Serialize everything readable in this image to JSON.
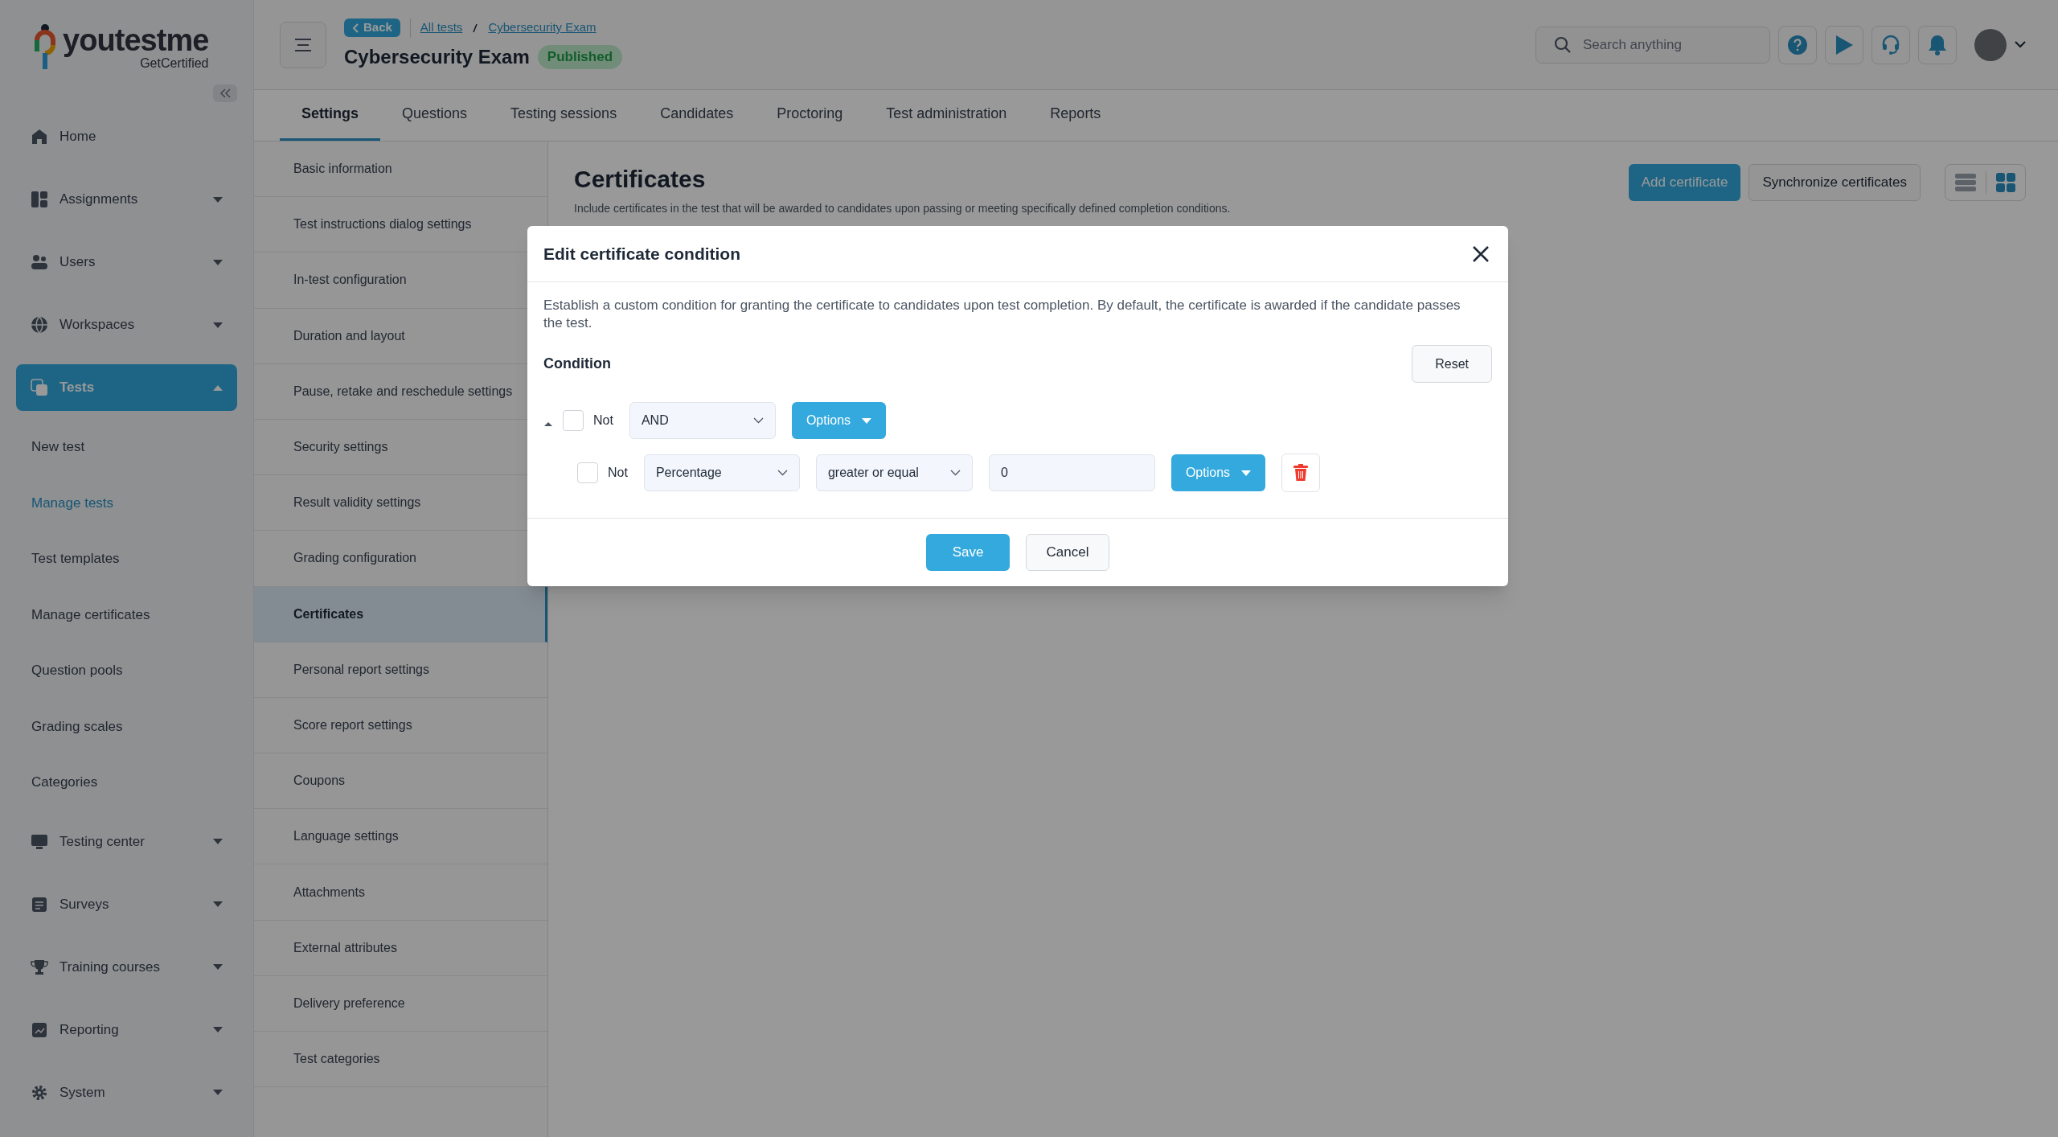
{
  "logo": {
    "name": "youtestme",
    "tagline": "GetCertified"
  },
  "sidebar": {
    "items": [
      {
        "label": "Home",
        "kind": "link",
        "selected": false
      },
      {
        "label": "Assignments",
        "kind": "group",
        "selected": false,
        "expanded": false
      },
      {
        "label": "Users",
        "kind": "group",
        "selected": false,
        "expanded": false
      },
      {
        "label": "Workspaces",
        "kind": "group",
        "selected": false,
        "expanded": false
      },
      {
        "label": "Tests",
        "kind": "group",
        "selected": true,
        "expanded": true,
        "children": [
          {
            "label": "New test",
            "selected": false
          },
          {
            "label": "Manage tests",
            "selected": true
          },
          {
            "label": "Test templates",
            "selected": false
          },
          {
            "label": "Manage certificates",
            "selected": false
          },
          {
            "label": "Question pools",
            "selected": false
          },
          {
            "label": "Grading scales",
            "selected": false
          },
          {
            "label": "Categories",
            "selected": false
          }
        ]
      },
      {
        "label": "Testing center",
        "kind": "group",
        "selected": false,
        "expanded": false
      },
      {
        "label": "Surveys",
        "kind": "group",
        "selected": false,
        "expanded": false
      },
      {
        "label": "Training courses",
        "kind": "group",
        "selected": false,
        "expanded": false
      },
      {
        "label": "Reporting",
        "kind": "group",
        "selected": false,
        "expanded": false
      },
      {
        "label": "System",
        "kind": "group",
        "selected": false,
        "expanded": false
      }
    ]
  },
  "header": {
    "back": "Back",
    "breadcrumbs": [
      "All tests",
      "Cybersecurity Exam"
    ],
    "title": "Cybersecurity Exam",
    "status": "Published",
    "search": {
      "placeholder": "Search anything"
    }
  },
  "tabs": [
    {
      "label": "Settings",
      "selected": true
    },
    {
      "label": "Questions",
      "selected": false
    },
    {
      "label": "Testing sessions",
      "selected": false
    },
    {
      "label": "Candidates",
      "selected": false
    },
    {
      "label": "Proctoring",
      "selected": false
    },
    {
      "label": "Test administration",
      "selected": false
    },
    {
      "label": "Reports",
      "selected": false
    }
  ],
  "settings_menu": [
    {
      "label": "Basic information",
      "selected": false
    },
    {
      "label": "Test instructions dialog settings",
      "selected": false
    },
    {
      "label": "In-test configuration",
      "selected": false
    },
    {
      "label": "Duration and layout",
      "selected": false
    },
    {
      "label": "Pause, retake and reschedule settings",
      "selected": false
    },
    {
      "label": "Security settings",
      "selected": false
    },
    {
      "label": "Result validity settings",
      "selected": false
    },
    {
      "label": "Grading configuration",
      "selected": false
    },
    {
      "label": "Certificates",
      "selected": true
    },
    {
      "label": "Personal report settings",
      "selected": false
    },
    {
      "label": "Score report settings",
      "selected": false
    },
    {
      "label": "Coupons",
      "selected": false
    },
    {
      "label": "Language settings",
      "selected": false
    },
    {
      "label": "Attachments",
      "selected": false
    },
    {
      "label": "External attributes",
      "selected": false
    },
    {
      "label": "Delivery preference",
      "selected": false
    },
    {
      "label": "Test categories",
      "selected": false
    }
  ],
  "content": {
    "title": "Certificates",
    "description": "Include certificates in the test that will be awarded to candidates upon passing or meeting specifically defined completion conditions.",
    "buttons": [
      "Add certificate",
      "Synchronize certificates"
    ],
    "view_toggle": [
      {
        "kind": "list",
        "selected": false
      },
      {
        "kind": "grid",
        "selected": true
      }
    ]
  },
  "dialog": {
    "title": "Edit certificate condition",
    "description": "Establish a custom condition for granting the certificate to candidates upon test completion. By default, the certificate is awarded if the candidate passes the test.",
    "condition_label": "Condition",
    "reset": "Reset",
    "group": {
      "expanded": true,
      "not_label": "Not",
      "negated": false,
      "operator": "AND",
      "options": "Options",
      "children": [
        {
          "not_label": "Not",
          "negated": false,
          "field": "Percentage",
          "comparison": "greater or equal",
          "value": "0",
          "options": "Options"
        }
      ]
    },
    "buttons": [
      "Save",
      "Cancel"
    ]
  }
}
